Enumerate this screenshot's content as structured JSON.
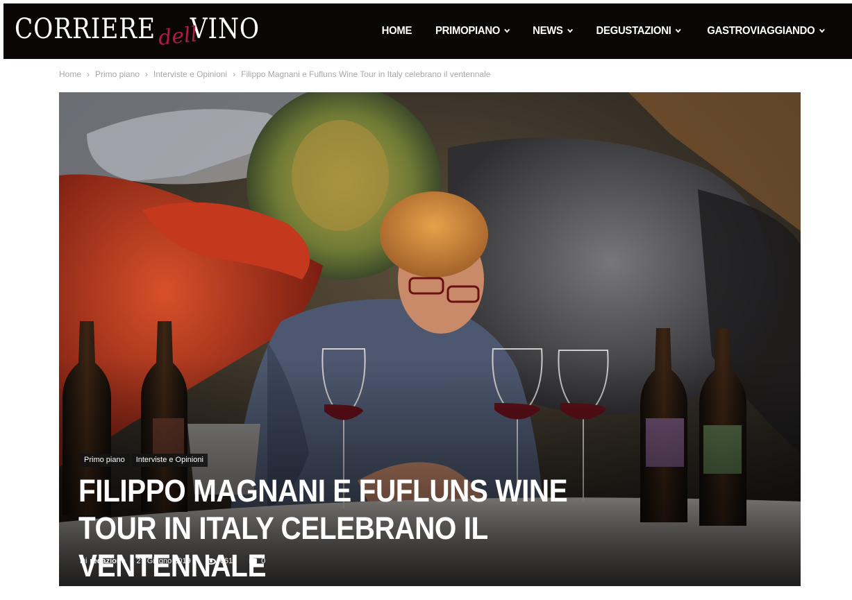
{
  "header": {
    "logo_main": "CORRIERE",
    "logo_script": "dell",
    "logo_end": "VINO",
    "nav": [
      {
        "label": "HOME",
        "dropdown": false
      },
      {
        "label": "PRIMOPIANO",
        "dropdown": true
      },
      {
        "label": "NEWS",
        "dropdown": true
      },
      {
        "label": "DEGUSTAZIONI",
        "dropdown": true
      },
      {
        "label": "GASTROVIAGGIANDO",
        "dropdown": true
      }
    ]
  },
  "breadcrumb": [
    "Home",
    "Primo piano",
    "Interviste e Opinioni",
    "Filippo Magnani e Fufluns Wine Tour in Italy celebrano il ventennale"
  ],
  "article": {
    "categories": [
      "Primo piano",
      "Interviste e Opinioni"
    ],
    "title": "Filippo Magnani e Fufluns Wine Tour in Italy celebrano il ventennale",
    "by_prefix": "Di",
    "author": "redazione",
    "date": "27 Giugno 2019",
    "views": "661",
    "comments": "0"
  },
  "colors": {
    "header_bg": "#0b0606",
    "logo_accent": "#b01b44"
  }
}
